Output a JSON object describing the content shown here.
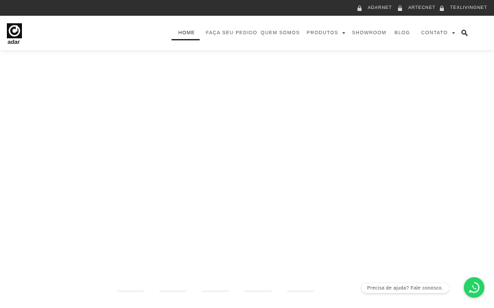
{
  "topbar": {
    "links": [
      {
        "label": "ADARNET",
        "icon": "lock-icon"
      },
      {
        "label": "ARTECNET",
        "icon": "lock-icon"
      },
      {
        "label": "TEXLIVINGNET",
        "icon": "lock-icon"
      }
    ],
    "background": "#2f2f2f"
  },
  "header": {
    "logo_text": "adar",
    "nav": [
      {
        "label": "HOME",
        "active": true
      },
      {
        "label": "FAÇA SEU PEDIDO"
      },
      {
        "label": "QUEM SOMOS"
      },
      {
        "label": "PRODUTOS",
        "dropdown": true
      },
      {
        "label": "SHOWROOM"
      },
      {
        "label": "BLOG"
      },
      {
        "label": "CONTATO",
        "dropdown": true
      }
    ],
    "search_icon": "search-icon"
  },
  "chat": {
    "bubble_text": "Precisa de ajuda? Fale conosco.",
    "button_icon": "whatsapp-icon",
    "color": "#25d366"
  }
}
